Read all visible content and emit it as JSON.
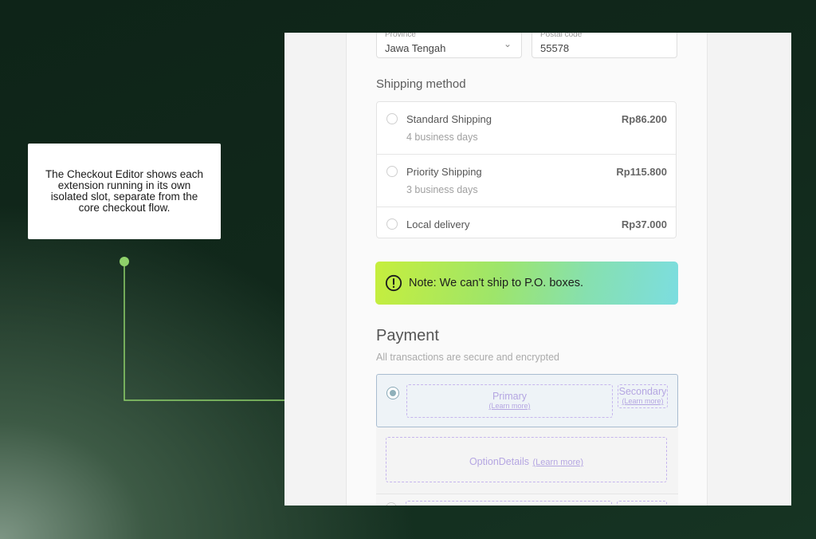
{
  "callout": {
    "text": "The Checkout Editor shows each extension running in its own isolated slot, separate from the core checkout flow."
  },
  "colors": {
    "accent_green": "#8fd16a",
    "background_dark": "#11281b",
    "dashed_slot": "#c6b6ee"
  },
  "address": {
    "province_label": "Province",
    "province_value": "Jawa Tengah",
    "postal_label": "Postal code",
    "postal_value": "55578"
  },
  "shipping": {
    "title": "Shipping method",
    "options": [
      {
        "name": "Standard Shipping",
        "detail": "4 business days",
        "price": "Rp86.200"
      },
      {
        "name": "Priority Shipping",
        "detail": "3 business days",
        "price": "Rp115.800"
      },
      {
        "name": "Local delivery",
        "detail": "",
        "price": "Rp37.000"
      }
    ]
  },
  "note": {
    "icon": "exclamation-circle-icon",
    "text": "Note: We can't ship to P.O. boxes."
  },
  "payment": {
    "title": "Payment",
    "subtitle": "All transactions are secure and encrypted",
    "primary_label": "Primary",
    "secondary_label": "Secondary",
    "learn_more": "(Learn more)",
    "option_details_label": "OptionDetails",
    "option_details_link": "(Learn more)"
  }
}
